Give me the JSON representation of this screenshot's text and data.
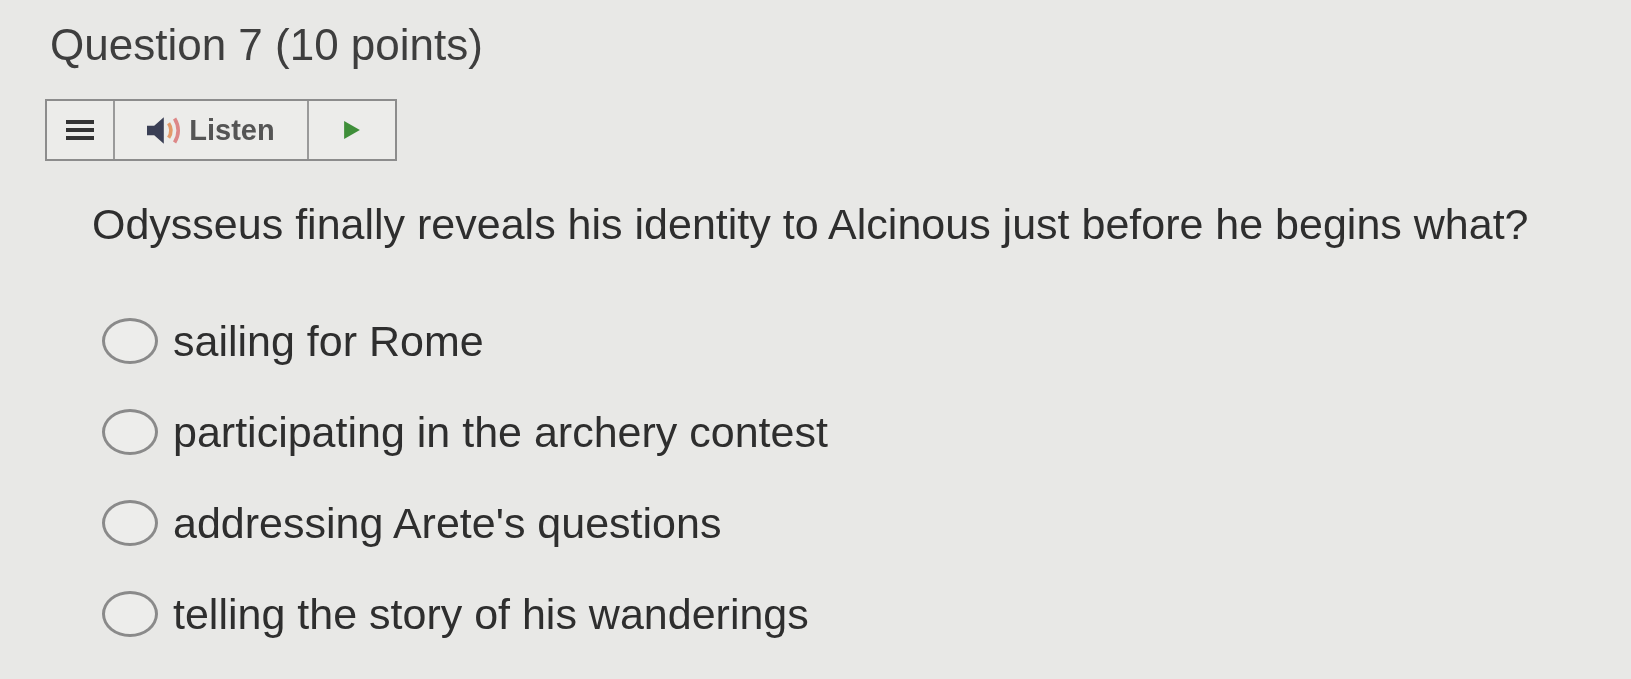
{
  "question": {
    "title": "Question 7 (10 points)",
    "prompt": "Odysseus finally reveals his identity to Alcinous just before he begins what?"
  },
  "toolbar": {
    "listen_label": "Listen"
  },
  "options": [
    {
      "label": "sailing for Rome",
      "selected": false
    },
    {
      "label": "participating in the archery contest",
      "selected": false
    },
    {
      "label": "addressing Arete's questions",
      "selected": false
    },
    {
      "label": "telling the story of his wanderings",
      "selected": false
    }
  ]
}
